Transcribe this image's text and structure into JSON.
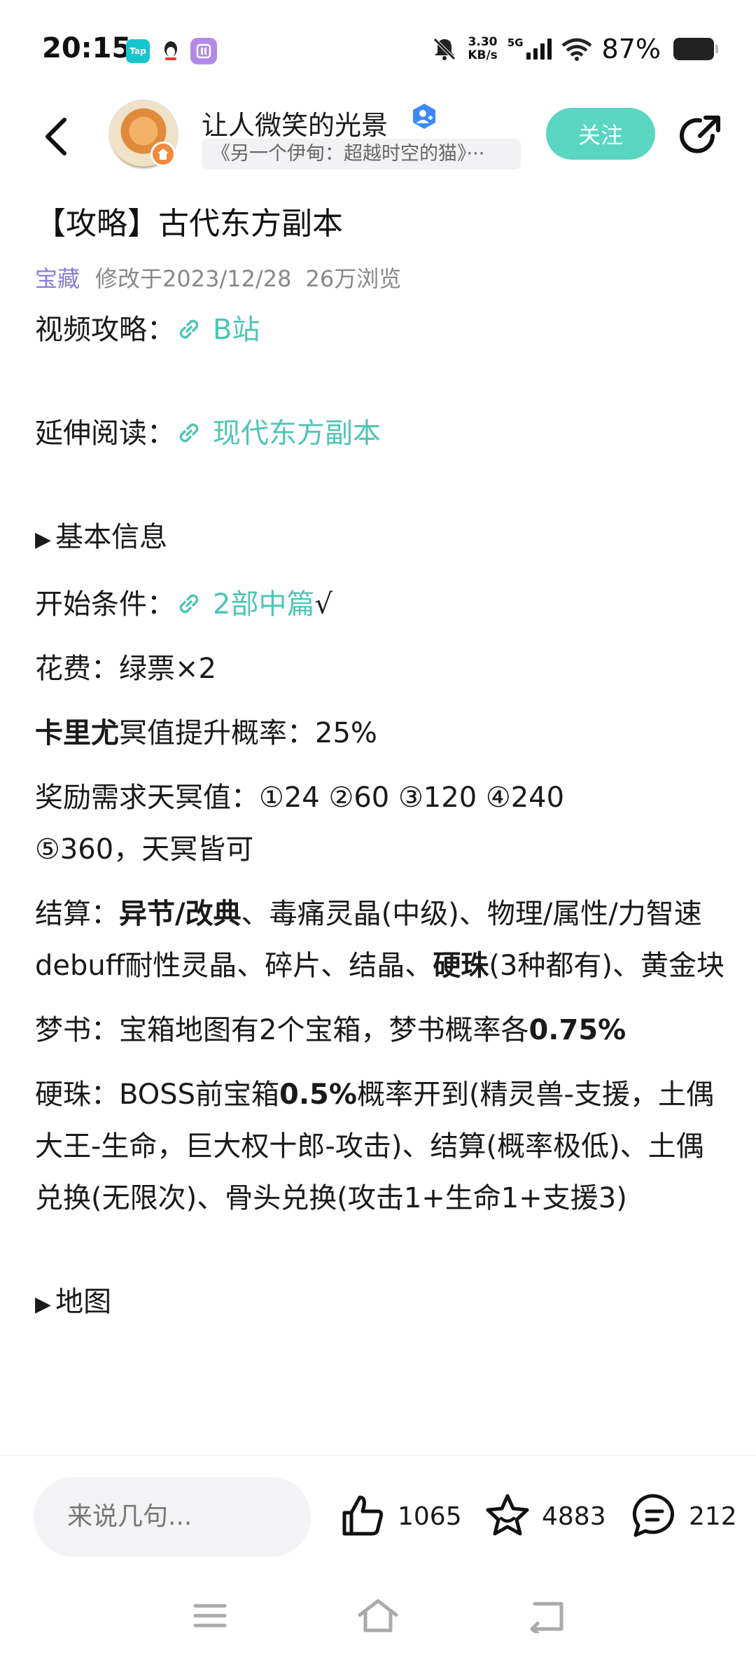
{
  "status_bar": {
    "time": "20:15",
    "app_tap_label": "Tap",
    "net_speed_value": "3.30",
    "net_speed_unit": "KB/s",
    "network_type": "5G",
    "battery_percent": "87%",
    "icons": [
      "tap-app-icon",
      "qq-icon",
      "purple-app-icon",
      "mute-bell-icon",
      "signal-icon",
      "wifi-icon",
      "battery-icon"
    ]
  },
  "header": {
    "author_name": "让人微笑的光景",
    "game_tag": "《另一个伊甸：超越时空的猫》···",
    "follow_label": "关注"
  },
  "article": {
    "title": "【攻略】古代东方副本",
    "tag": "宝藏",
    "modified": "修改于2023/12/28",
    "views": "26万浏览",
    "video_label": "视频攻略：",
    "video_link": "B站",
    "extend_label": "延伸阅读：",
    "extend_link": "现代东方副本",
    "section_basic": "基本信息",
    "start_label": "开始条件：",
    "start_link": "2部中篇",
    "start_suffix": "√",
    "cost": "花费：绿票×2",
    "karyu_bold": "卡里尤",
    "karyu_rest": "冥值提升概率：25%",
    "reward_line1": "奖励需求天冥值：①24 ②60 ③120 ④240",
    "reward_line2": "⑤360，天冥皆可",
    "settle_label": "结算：",
    "settle_bold1": "异节/改典",
    "settle_mid": "、毒痛灵晶(中级)、物理/属性/力智速debuff耐性灵晶、碎片、结晶、",
    "settle_bold2": "硬珠",
    "settle_end": "(3种都有)、黄金块",
    "dream_label": "梦书：",
    "dream_text": "宝箱地图有2个宝箱，梦书概率各",
    "dream_bold": "0.75%",
    "hard_label": "硬珠：",
    "hard_text1": "BOSS前宝箱",
    "hard_bold": "0.5%",
    "hard_text2": "概率开到(精灵兽-支援，土偶大王-生命，巨大权十郎-攻击)、结算(概率极低)、土偶兑换(无限次)、骨头兑换(攻击1+生命1+支援3)",
    "section_map": "地图"
  },
  "bottom_bar": {
    "comment_placeholder": "来说几句...",
    "likes": "1065",
    "favorites": "4883",
    "comments": "212"
  },
  "colors": {
    "accent": "#5ad6c3",
    "link": "#4fc5b6",
    "tag": "#8b7bd8",
    "meta": "#888888"
  }
}
